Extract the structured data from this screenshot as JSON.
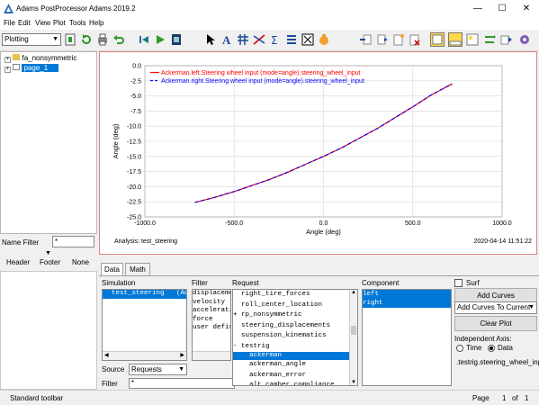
{
  "window": {
    "title": "Adams PostProcessor Adams 2019.2",
    "minimize": "—",
    "maximize": "☐",
    "close": "✕"
  },
  "menu": [
    "File",
    "Edit",
    "View",
    "Plot",
    "Tools",
    "Help"
  ],
  "toolbar": {
    "mode": "Plotting"
  },
  "tree": {
    "items": [
      "fa_nonsymmetric",
      "page_1"
    ]
  },
  "filter": {
    "label": "Name Filter",
    "value": "*"
  },
  "hfn": {
    "header": "Header",
    "footer": "Footer",
    "none": "None"
  },
  "chart_data": {
    "type": "line",
    "xlabel": "Angle (deg)",
    "ylabel": "Angle (deg)",
    "xlim": [
      -1000,
      1000
    ],
    "ylim": [
      -25,
      0
    ],
    "x_ticks": [
      "-1000.0",
      "-500.0",
      "0.0",
      "500.0",
      "1000.0"
    ],
    "y_ticks": [
      "0.0",
      "-2.5",
      "-5.0",
      "-7.5",
      "-10.0",
      "-12.5",
      "-15.0",
      "-17.5",
      "-20.0",
      "-22.5",
      "-25.0"
    ],
    "grid": true,
    "legend_position": "top-left",
    "series": [
      {
        "name": "Ackerman.left.Steering wheel input (mode=angle).steering_wheel_input",
        "color": "#ff0000",
        "style": "solid",
        "x": [
          -720,
          -600,
          -500,
          -400,
          -300,
          -200,
          -100,
          0,
          100,
          200,
          300,
          400,
          500,
          600,
          720
        ],
        "y": [
          -22.6,
          -21.7,
          -20.8,
          -19.8,
          -18.8,
          -17.6,
          -16.3,
          -15.0,
          -13.6,
          -12.0,
          -10.4,
          -8.6,
          -6.8,
          -4.9,
          -3.0
        ]
      },
      {
        "name": "Ackerman.right.Steering wheel input (mode=angle).steering_wheel_input",
        "color": "#0000ff",
        "style": "dashed",
        "x": [
          -720,
          -600,
          -500,
          -400,
          -300,
          -200,
          -100,
          0,
          100,
          200,
          300,
          400,
          500,
          600,
          720
        ],
        "y": [
          -22.6,
          -21.7,
          -20.8,
          -19.8,
          -18.8,
          -17.6,
          -16.3,
          -15.0,
          -13.6,
          -12.0,
          -10.4,
          -8.6,
          -6.8,
          -4.9,
          -3.0
        ]
      }
    ],
    "footer_left": "Analysis:  test_steering",
    "footer_right": "2020-04-14 11:51:22"
  },
  "tabs": [
    "Data",
    "Math"
  ],
  "simulation": {
    "label": "Simulation",
    "items": [
      "test_steering   (Adam"
    ]
  },
  "source": {
    "label": "Source",
    "value": "Requests"
  },
  "filterbox": {
    "label": "Filter",
    "value": "*"
  },
  "filter_list": {
    "label": "Filter",
    "items": [
      "displaceme",
      "velocity",
      "accelerati",
      "force",
      "user defir"
    ]
  },
  "request": {
    "label": "Request",
    "items": [
      "  right_tire_forces",
      "  roll_center_location",
      "+ rp_nonsymmetric",
      "  steering_displacements",
      "  suspension_kinematics",
      "- testrig",
      "    ackerman",
      "    ackerman_angle",
      "    ackerman_error",
      "    alt_camber_compliance"
    ]
  },
  "component": {
    "label": "Component",
    "items": [
      "left",
      "right"
    ]
  },
  "controls": {
    "surf": "Surf",
    "add_curves": "Add Curves",
    "add_mode": "Add Curves To Current",
    "clear": "Clear Plot",
    "indep_label": "Independent Axis:",
    "time": "Time",
    "data": "Data",
    "indep_value": ".testrig.steering_wheel_inp"
  },
  "status": {
    "text": "Standard toolbar",
    "page_label": "Page",
    "page": "1",
    "of": "of",
    "total": "1"
  }
}
